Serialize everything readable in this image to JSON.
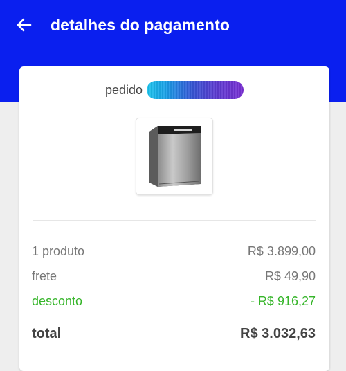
{
  "header": {
    "title": "detalhes do pagamento",
    "back_icon": "arrow-left-icon",
    "background_color": "#0a1fef"
  },
  "order": {
    "label": "pedido",
    "id_redacted": true
  },
  "product": {
    "image_icon": "dishwasher-product-image"
  },
  "summary": {
    "items": {
      "label": "1 produto",
      "value": "R$ 3.899,00"
    },
    "shipping": {
      "label": "frete",
      "value": "R$ 49,90"
    },
    "discount": {
      "label": "desconto",
      "value": "- R$ 916,27",
      "color": "#36b52a"
    },
    "total": {
      "label": "total",
      "value": "R$ 3.032,63"
    }
  }
}
